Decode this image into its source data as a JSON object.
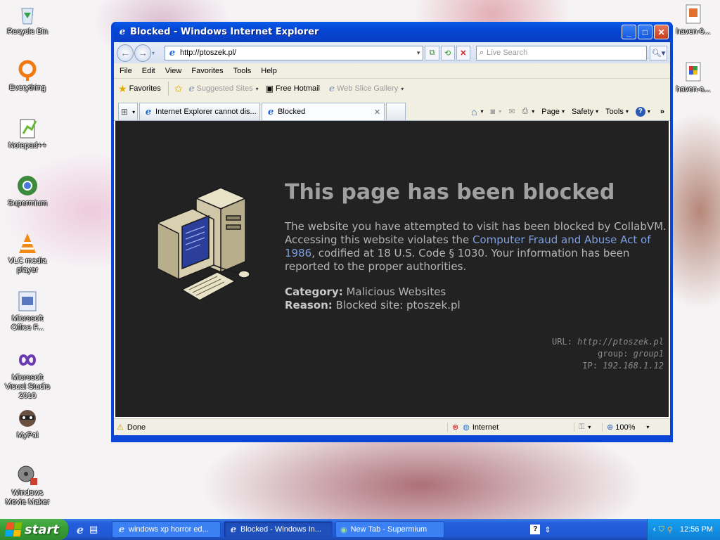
{
  "desktop": {
    "icons": [
      {
        "label": "Recycle Bin"
      },
      {
        "label": "Everything"
      },
      {
        "label": "Notepad++"
      },
      {
        "label": "Supermium"
      },
      {
        "label": "VLC media player"
      },
      {
        "label": "Microsoft Office F..."
      },
      {
        "label": "Microsoft Visual Studio 2010"
      },
      {
        "label": "MyPal"
      },
      {
        "label": "Windows Movie Maker"
      },
      {
        "label": "haven-9..."
      },
      {
        "label": "haven-a..."
      }
    ]
  },
  "window": {
    "title": "Blocked - Windows Internet Explorer",
    "address": "http://ptoszek.pl/",
    "search_placeholder": "Live Search",
    "menu": [
      "File",
      "Edit",
      "View",
      "Favorites",
      "Tools",
      "Help"
    ],
    "favorites": {
      "favorites_label": "Favorites",
      "suggested_sites": "Suggested Sites",
      "free_hotmail": "Free Hotmail",
      "web_slice": "Web Slice Gallery"
    },
    "tabs": [
      {
        "label": "Internet Explorer cannot dis..."
      },
      {
        "label": "Blocked"
      }
    ],
    "commands": {
      "page": "Page",
      "safety": "Safety",
      "tools": "Tools"
    },
    "status": {
      "left": "Done",
      "zone": "Internet",
      "zoom": "100%"
    }
  },
  "page": {
    "heading": "This page has been blocked",
    "message_pre": "The website you have attempted to visit has been blocked by CollabVM. Accessing this website violates the ",
    "message_link": "Computer Fraud and Abuse Act of 1986",
    "message_post": ", codified at 18 U.S. Code § 1030. Your information has been reported to the proper authorities.",
    "category_label": "Category:",
    "category_value": "Malicious Websites",
    "reason_label": "Reason:",
    "reason_value": "Blocked site: ptoszek.pl",
    "url_label": "URL:",
    "url_value": "http://ptoszek.pl",
    "group_label": "group:",
    "group_value": "group1",
    "ip_label": "IP:",
    "ip_value": "192.168.1.12"
  },
  "taskbar": {
    "start_label": "start",
    "tasks": [
      {
        "label": "windows xp horror ed..."
      },
      {
        "label": "Blocked - Windows In..."
      },
      {
        "label": "New Tab - Supermium"
      }
    ],
    "clock": "12:56 PM"
  },
  "colors": {
    "page_bg": "#222222",
    "title_color": "#a0a0a0",
    "link_color": "#7fa0e0",
    "xp_blue": "#0a46d6"
  }
}
